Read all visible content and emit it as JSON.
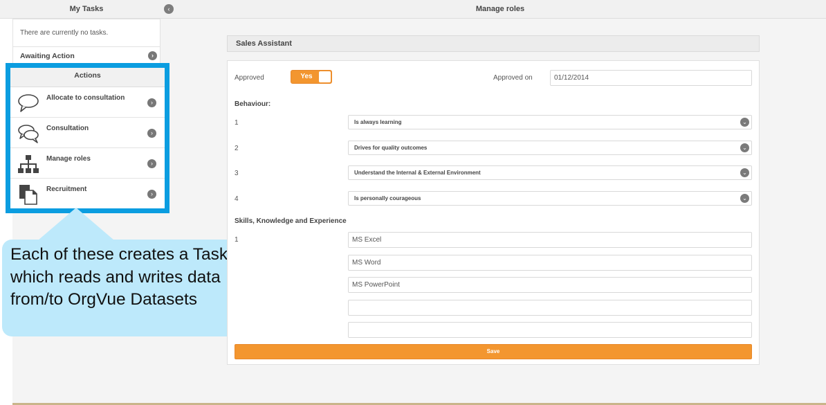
{
  "header": {
    "left_title": "My Tasks",
    "main_title": "Manage roles",
    "back_glyph": "‹"
  },
  "sidebar": {
    "no_tasks_text": "There are currently no tasks.",
    "awaiting_label": "Awaiting Action",
    "actions_title": "Actions",
    "actions": [
      {
        "label": "Allocate to consultation",
        "icon": "speech-bubble-icon"
      },
      {
        "label": "Consultation",
        "icon": "conversation-icon"
      },
      {
        "label": "Manage roles",
        "icon": "org-chart-icon"
      },
      {
        "label": "Recruitment",
        "icon": "documents-icon"
      }
    ],
    "chevron_glyph": "›"
  },
  "callout": {
    "text": "Each of these creates a Task which reads and writes data from/to OrgVue Datasets"
  },
  "form": {
    "title": "Sales Assistant",
    "approved_label": "Approved",
    "approved_toggle": "Yes",
    "approved_on_label": "Approved on",
    "approved_on_value": "01/12/2014",
    "behaviour_label": "Behaviour:",
    "behaviours": [
      {
        "num": "1",
        "value": "Is always learning"
      },
      {
        "num": "2",
        "value": "Drives for quality outcomes"
      },
      {
        "num": "3",
        "value": "Understand the Internal & External Environment"
      },
      {
        "num": "4",
        "value": "Is personally courageous"
      }
    ],
    "skills_label": "Skills, Knowledge and Experience",
    "skills_first_num": "1",
    "skills": [
      "MS Excel",
      "MS Word",
      "MS PowerPoint",
      "",
      ""
    ],
    "dropdown_glyph": "⌄",
    "save_label": "Save"
  },
  "colors": {
    "accent_orange": "#f3962f",
    "highlight_blue": "#0b9de0",
    "callout_bg": "#bde9fb"
  }
}
